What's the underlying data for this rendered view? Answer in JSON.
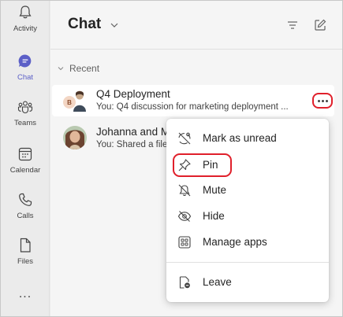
{
  "rail": {
    "items": [
      {
        "label": "Activity",
        "icon": "bell-icon"
      },
      {
        "label": "Chat",
        "icon": "chat-icon"
      },
      {
        "label": "Teams",
        "icon": "teams-icon"
      },
      {
        "label": "Calendar",
        "icon": "calendar-icon"
      },
      {
        "label": "Calls",
        "icon": "phone-icon"
      },
      {
        "label": "Files",
        "icon": "file-icon"
      }
    ],
    "more": "...",
    "active_color": "#5b5fc7"
  },
  "header": {
    "title": "Chat",
    "filter_icon": "filter-icon",
    "compose_icon": "compose-icon"
  },
  "section": {
    "label": "Recent"
  },
  "chats": [
    {
      "title": "Q4 Deployment",
      "preview": "You: Q4 discussion for marketing deployment ...",
      "avatar_initial": "B"
    },
    {
      "title": "Johanna and M",
      "preview": "You: Shared a file"
    }
  ],
  "menu": {
    "items": [
      {
        "label": "Mark as unread",
        "icon": "mark-unread-icon"
      },
      {
        "label": "Pin",
        "icon": "pin-icon"
      },
      {
        "label": "Mute",
        "icon": "mute-bell-icon"
      },
      {
        "label": "Hide",
        "icon": "hide-eye-icon"
      },
      {
        "label": "Manage apps",
        "icon": "apps-grid-icon"
      },
      {
        "label": "Leave",
        "icon": "leave-icon"
      }
    ]
  },
  "colors": {
    "highlight": "#e0202b",
    "brand": "#5b5fc7"
  }
}
